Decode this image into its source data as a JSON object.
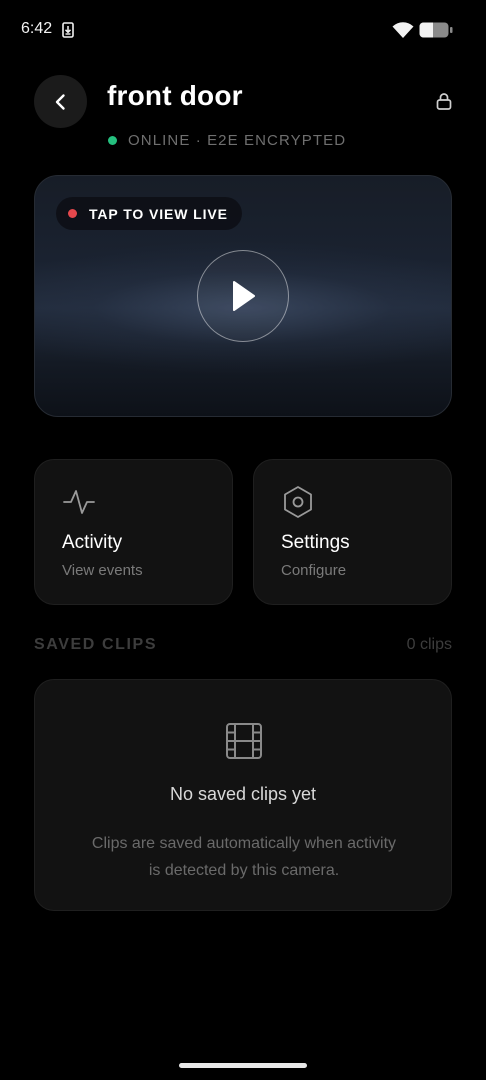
{
  "status_bar": {
    "time": "6:42",
    "icons": [
      "download-icon",
      "wifi-icon",
      "battery-icon"
    ]
  },
  "header": {
    "back_icon": "chevron-left-icon",
    "title": "front door",
    "lock_icon": "lock-icon",
    "status_text": "ONLINE · E2E ENCRYPTED",
    "status_color": "#25c07f"
  },
  "live": {
    "label": "TAP TO VIEW LIVE",
    "dot_color": "#e5484d",
    "play_icon": "play-icon"
  },
  "actions": [
    {
      "title": "Activity",
      "subtitle": "View events",
      "icon": "activity-pulse-icon"
    },
    {
      "title": "Settings",
      "subtitle": "Configure",
      "icon": "gear-icon"
    }
  ],
  "clips": {
    "section_title": "SAVED CLIPS",
    "count": "0 clips",
    "empty_icon": "film-icon",
    "empty_title": "No saved clips yet",
    "empty_line1": "Clips are saved automatically when activity",
    "empty_line2": "is detected by this camera."
  }
}
